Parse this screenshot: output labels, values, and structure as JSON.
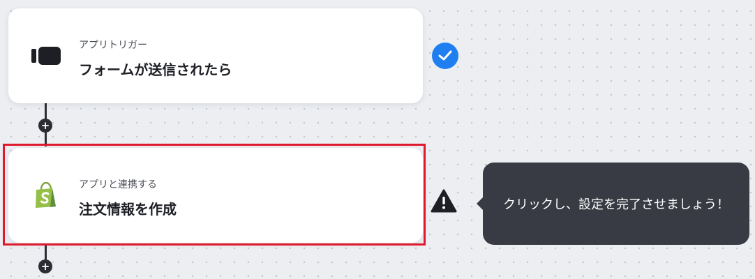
{
  "flow": {
    "step1": {
      "label": "アプリトリガー",
      "title": "フォームが送信されたら",
      "icon": "form-trigger-icon",
      "status": "complete",
      "status_icon": "check-circle-icon"
    },
    "step2": {
      "label": "アプリと連携する",
      "title": "注文情報を作成",
      "icon": "shopify-icon",
      "status": "warning",
      "status_icon": "warning-icon"
    },
    "add_step": {
      "glyph": "+"
    }
  },
  "tooltip": {
    "text": "クリックし、設定を完了させましょう！"
  },
  "colors": {
    "accent": "#1f7ff0",
    "highlight_border": "#e0192c",
    "tooltip_bg": "#383b43",
    "connector": "#2b2d33",
    "shopify_green": "#95bf47"
  }
}
